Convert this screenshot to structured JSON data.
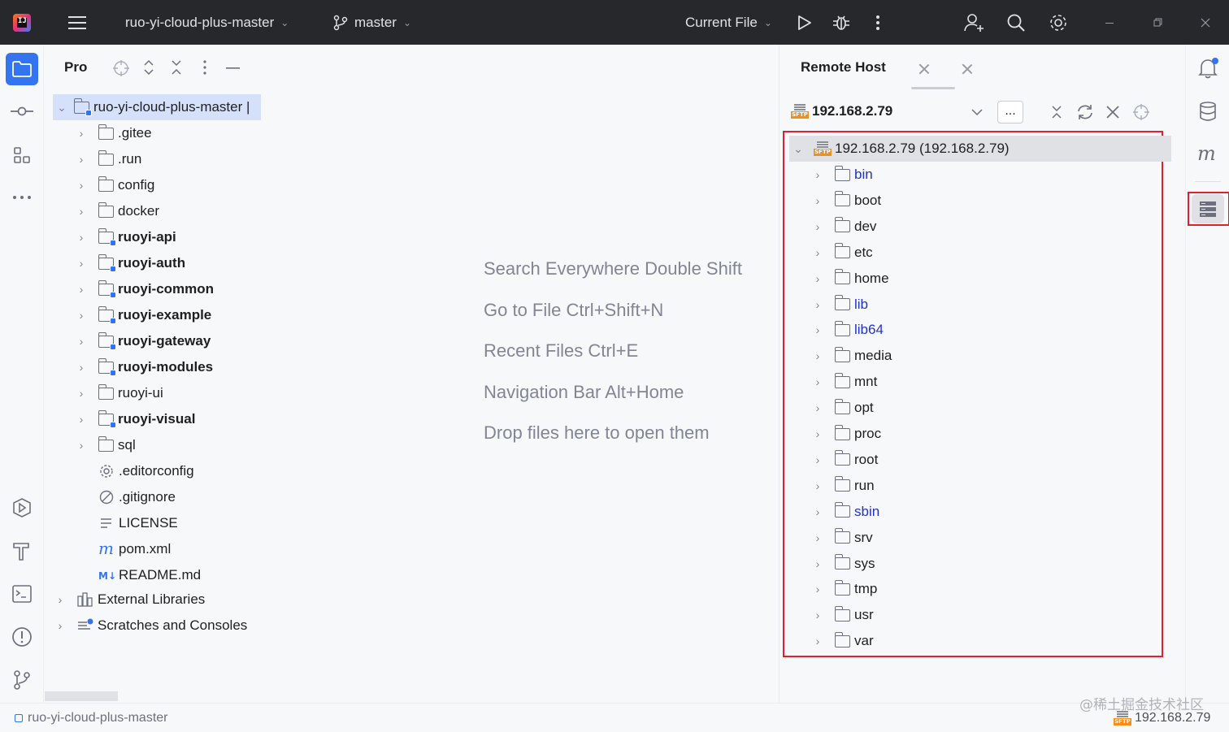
{
  "titlebar": {
    "project": "ruo-yi-cloud-plus-master",
    "branch": "master",
    "run_config": "Current File"
  },
  "project_pane": {
    "title": "Pro",
    "root": "ruo-yi-cloud-plus-master",
    "items": [
      {
        "label": ".gitee",
        "kind": "folder"
      },
      {
        "label": ".run",
        "kind": "folder"
      },
      {
        "label": "config",
        "kind": "folder"
      },
      {
        "label": "docker",
        "kind": "folder"
      },
      {
        "label": "ruoyi-api",
        "kind": "module"
      },
      {
        "label": "ruoyi-auth",
        "kind": "module"
      },
      {
        "label": "ruoyi-common",
        "kind": "module"
      },
      {
        "label": "ruoyi-example",
        "kind": "module"
      },
      {
        "label": "ruoyi-gateway",
        "kind": "module"
      },
      {
        "label": "ruoyi-modules",
        "kind": "module"
      },
      {
        "label": "ruoyi-ui",
        "kind": "folder"
      },
      {
        "label": "ruoyi-visual",
        "kind": "module"
      },
      {
        "label": "sql",
        "kind": "folder"
      },
      {
        "label": ".editorconfig",
        "kind": "gear"
      },
      {
        "label": ".gitignore",
        "kind": "ignore"
      },
      {
        "label": "LICENSE",
        "kind": "text"
      },
      {
        "label": "pom.xml",
        "kind": "maven"
      },
      {
        "label": "README.md",
        "kind": "markdown"
      }
    ],
    "external_libraries": "External Libraries",
    "scratches": "Scratches and Consoles"
  },
  "editor_hints": [
    "Search Everywhere Double Shift",
    "Go to File Ctrl+Shift+N",
    "Recent Files Ctrl+E",
    "Navigation Bar Alt+Home",
    "Drop files here to open them"
  ],
  "remote_host": {
    "tab": "Remote Host",
    "host": "192.168.2.79",
    "ellipsis": "...",
    "root": "192.168.2.79 (192.168.2.79)",
    "dirs": [
      {
        "label": "bin",
        "link": true
      },
      {
        "label": "boot",
        "link": false
      },
      {
        "label": "dev",
        "link": false
      },
      {
        "label": "etc",
        "link": false
      },
      {
        "label": "home",
        "link": false
      },
      {
        "label": "lib",
        "link": true
      },
      {
        "label": "lib64",
        "link": true
      },
      {
        "label": "media",
        "link": false
      },
      {
        "label": "mnt",
        "link": false
      },
      {
        "label": "opt",
        "link": false
      },
      {
        "label": "proc",
        "link": false
      },
      {
        "label": "root",
        "link": false
      },
      {
        "label": "run",
        "link": false
      },
      {
        "label": "sbin",
        "link": true
      },
      {
        "label": "srv",
        "link": false
      },
      {
        "label": "sys",
        "link": false
      },
      {
        "label": "tmp",
        "link": false
      },
      {
        "label": "usr",
        "link": false
      },
      {
        "label": "var",
        "link": false
      }
    ]
  },
  "statusbar": {
    "project": "ruo-yi-cloud-plus-master",
    "host": "192.168.2.79"
  },
  "watermark": "@稀土掘金技术社区",
  "colors": {
    "accent": "#3574f0",
    "highlight_box": "#e0202a",
    "link": "#2033c4",
    "titlebar": "#27282c"
  }
}
